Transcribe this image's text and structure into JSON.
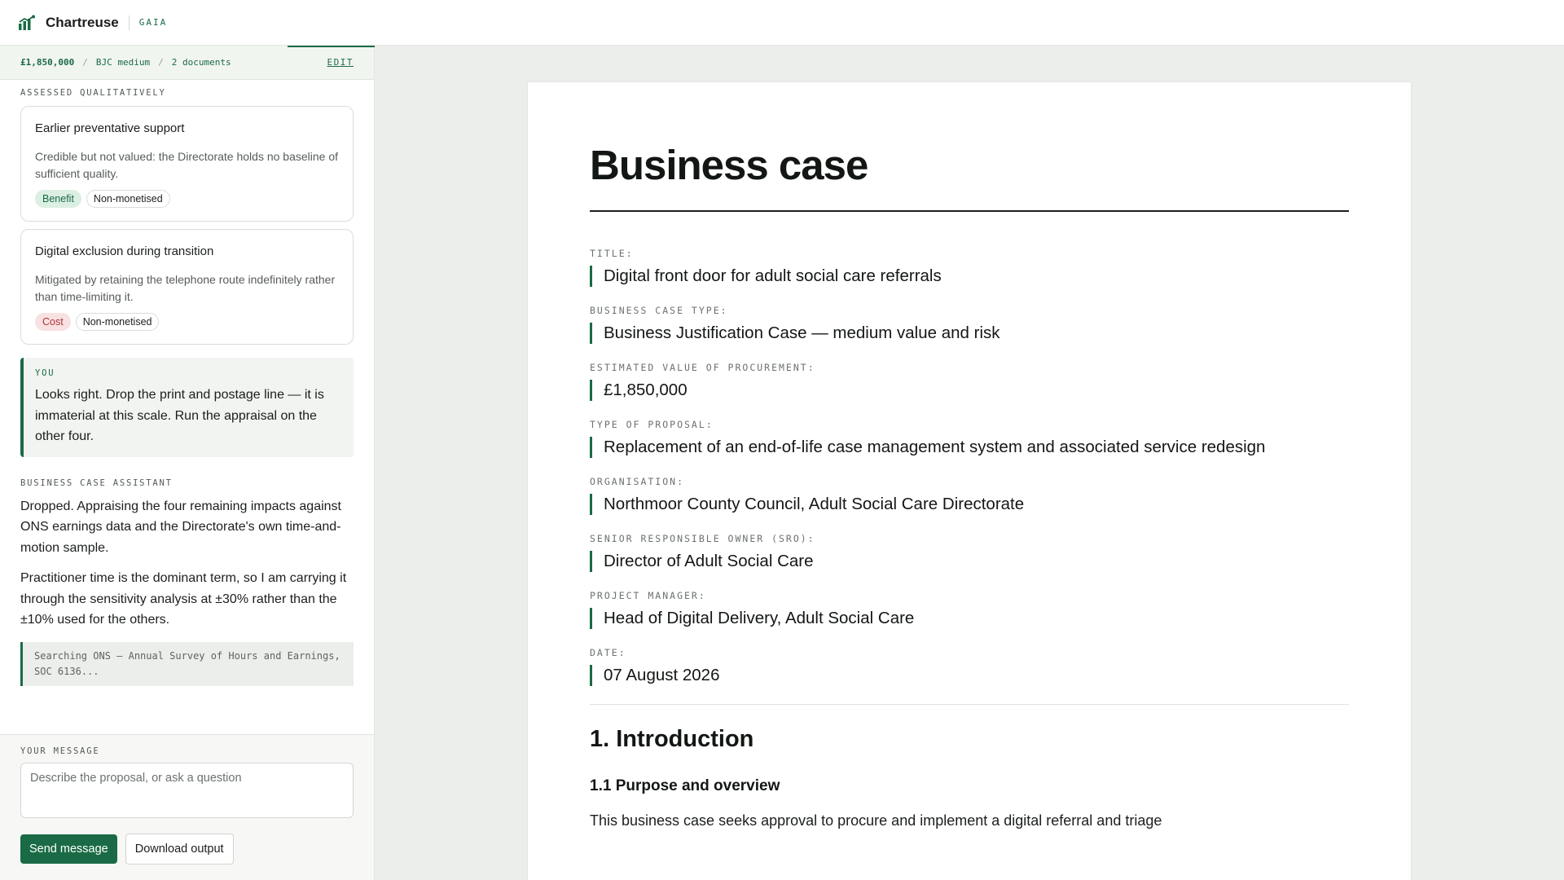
{
  "app": {
    "name": "Chartreuse",
    "tag": "GAIA"
  },
  "summary": {
    "value": "£1,850,000",
    "case_type": "BJC medium",
    "documents": "2 documents",
    "edit_label": "EDIT"
  },
  "sidebar": {
    "section_label": "ASSESSED QUALITATIVELY",
    "cards": [
      {
        "title": "Earlier preventative support",
        "description": "Credible but not valued: the Directorate holds no baseline of sufficient quality.",
        "chips": [
          "Benefit",
          "Non-monetised"
        ]
      },
      {
        "title": "Digital exclusion during transition",
        "description": "Mitigated by retaining the telephone route indefinitely rather than time-limiting it.",
        "chips": [
          "Cost",
          "Non-monetised"
        ]
      }
    ],
    "you_label": "YOU",
    "you_text": "Looks right. Drop the print and postage line — it is immaterial at this scale. Run the appraisal on the other four.",
    "assistant_label": "BUSINESS CASE ASSISTANT",
    "assistant_paragraphs": [
      "Dropped. Appraising the four remaining impacts against ONS earnings data and the Directorate's own time-and-motion sample.",
      "Practitioner time is the dominant term, so I am carrying it through the sensitivity analysis at ±30% rather than the ±10% used for the others."
    ],
    "search_status": "Searching ONS — Annual Survey of Hours and Earnings, SOC 6136..."
  },
  "composer": {
    "label": "YOUR MESSAGE",
    "placeholder": "Describe the proposal, or ask a question",
    "value": "",
    "send_label": "Send message",
    "download_label": "Download output"
  },
  "document": {
    "title": "Business case",
    "fields": [
      {
        "label": "TITLE:",
        "value": "Digital front door for adult social care referrals"
      },
      {
        "label": "BUSINESS CASE TYPE:",
        "value": "Business Justification Case — medium value and risk"
      },
      {
        "label": "ESTIMATED VALUE OF PROCUREMENT:",
        "value": "£1,850,000"
      },
      {
        "label": "TYPE OF PROPOSAL:",
        "value": "Replacement of an end-of-life case management system and associated service redesign"
      },
      {
        "label": "ORGANISATION:",
        "value": "Northmoor County Council, Adult Social Care Directorate"
      },
      {
        "label": "SENIOR RESPONSIBLE OWNER (SRO):",
        "value": "Director of Adult Social Care"
      },
      {
        "label": "PROJECT MANAGER:",
        "value": "Head of Digital Delivery, Adult Social Care"
      },
      {
        "label": "DATE:",
        "value": "07 August 2026"
      }
    ],
    "section_heading": "1. Introduction",
    "subsection_heading": "1.1 Purpose and overview",
    "paragraph": "This business case seeks approval to procure and implement a digital referral and triage"
  },
  "colors": {
    "accent": "#1a6b45",
    "benefit_bg": "#dcefe3",
    "cost_bg": "#f8e1e1",
    "cost_text": "#b0343a"
  },
  "icons": {
    "logo": "bar-chart-logo-icon"
  }
}
